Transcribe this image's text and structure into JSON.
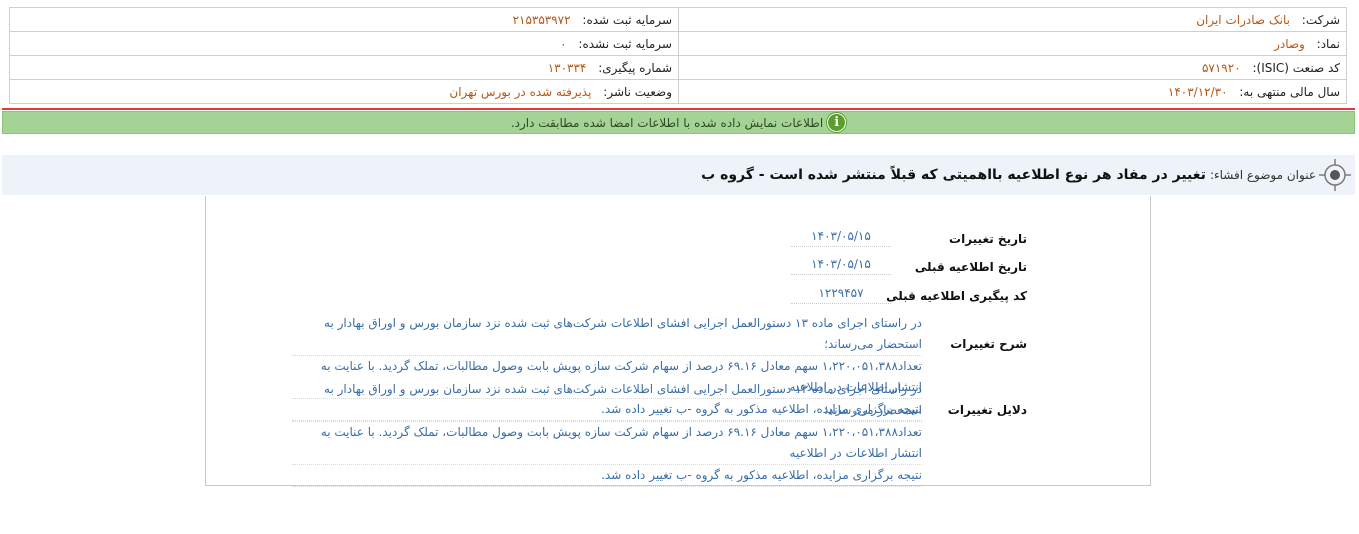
{
  "header": {
    "company_label": "شرکت:",
    "company_value": "بانک صادرات ایران",
    "symbol_label": "نماد:",
    "symbol_value": "وصادر",
    "isic_label": "کد صنعت (ISIC):",
    "isic_value": "۵۷۱۹۲۰",
    "fiscal_label": "سال مالی منتهی به:",
    "fiscal_value": "۱۴۰۳/۱۲/۳۰",
    "reg_capital_label": "سرمایه ثبت شده:",
    "reg_capital_value": "۲۱۵۳۵۳۹۷۲",
    "unreg_capital_label": "سرمایه ثبت نشده:",
    "unreg_capital_value": "۰",
    "tracking_label": "شماره پیگیری:",
    "tracking_value": "۱۳۰۳۳۴",
    "publisher_status_label": "وضعیت ناشر:",
    "publisher_status_value": "پذیرفته شده در بورس تهران"
  },
  "verify": {
    "message": "اطلاعات نمایش داده شده با اطلاعات امضا شده مطابقت دارد.",
    "icon": "info-icon",
    "accent": "#a5d396"
  },
  "title": {
    "prefix": "عنوان موضوع افشاء:",
    "text": "تغییر در مفاد هر نوع اطلاعیه بااهمیتی که قبلاً منتشر شده است - گروه ب"
  },
  "details": {
    "change_date_label": "تاریخ تغییرات",
    "change_date_value": "۱۴۰۳/۰۵/۱۵",
    "prev_notice_date_label": "تاریخ اطلاعیه قبلی",
    "prev_notice_date_value": "۱۴۰۳/۰۵/۱۵",
    "prev_tracking_label": "کد پیگیری اطلاعیه قبلی",
    "prev_tracking_value": "۱۲۲۹۴۵۷",
    "change_desc_label": "شرح تغییرات",
    "change_desc_lines": [
      "در راستای اجرای ماده ۱۳ دستورالعمل اجرایی افشای اطلاعات شرکت‌های ثبت شده نزد سازمان بورس و اوراق بهادار به استحضار می‌رساند؛",
      "تعداد۱،۲۲۰،۰۵۱،۳۸۸ سهم معادل ۶۹.۱۶ درصد از سهام شرکت سازه پویش بابت وصول مطالبات، تملک گردید. با عنایت به انتشار اطلاعات در اطلاعیه",
      "نتیجه برگزاری مزایده، اطلاعیه مذکور به گروه -ب تغییر داده شد."
    ],
    "change_reasons_label": "دلایل تغییرات",
    "change_reasons_lines": [
      "در راستای اجرای ماده ۱۳ دستورالعمل اجرایی افشای اطلاعات شرکت‌های ثبت شده نزد سازمان بورس و اوراق بهادار به استحضار می‌رساند؛",
      "تعداد۱،۲۲۰،۰۵۱،۳۸۸ سهم معادل ۶۹.۱۶ درصد از سهام شرکت سازه پویش بابت وصول مطالبات، تملک گردید. با عنایت به انتشار اطلاعات در اطلاعیه",
      "نتیجه برگزاری مزایده، اطلاعیه مذکور به گروه -ب تغییر داده شد."
    ]
  }
}
